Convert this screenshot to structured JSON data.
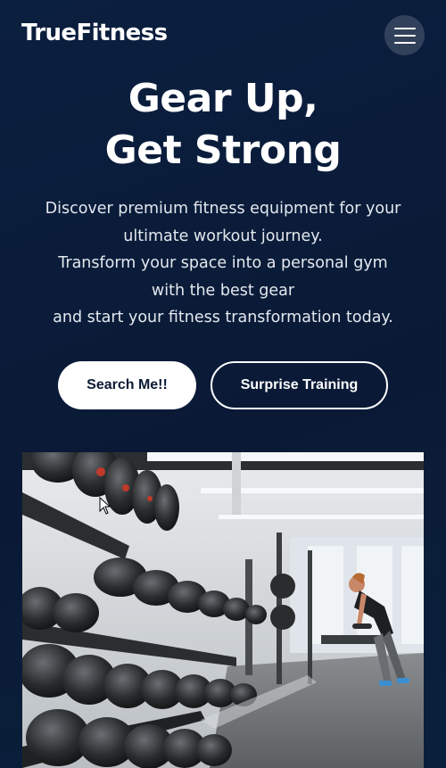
{
  "header": {
    "logo": "TrueFitness",
    "menu_icon": "hamburger-icon"
  },
  "hero": {
    "title_line1": "Gear Up,",
    "title_line2": "Get Strong",
    "description_lines": [
      "Discover premium fitness equipment for your",
      "ultimate workout journey.",
      "Transform your space into a personal gym",
      "with the best gear",
      "and start your fitness transformation today."
    ],
    "primary_button": "Search Me!!",
    "secondary_button": "Surprise Training"
  },
  "image": {
    "subject": "gym dumbbell rack with person training"
  },
  "colors": {
    "background": "#0a1a36",
    "text": "#ffffff",
    "primary_button_bg": "#ffffff",
    "primary_button_text": "#0b1b33"
  }
}
